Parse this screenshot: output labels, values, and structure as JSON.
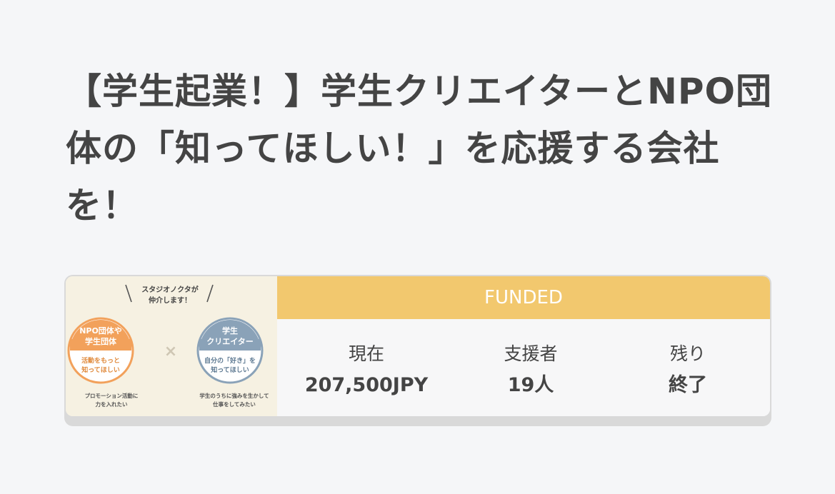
{
  "project": {
    "title": "【学生起業！】学生クリエイターとNPO団体の「知ってほしい！」を応援する会社を！"
  },
  "thumbnail": {
    "tagline": "スタジオノクタが仲介します！",
    "left_circle_title": "NPO団体や学生団体",
    "left_circle_sub": "活動をもっと知ってほしい",
    "right_circle_title": "学生クリエイター",
    "right_circle_sub": "自分の「好き」を知ってほしい",
    "cross": "×",
    "left_caption": "プロモーション活動に力を入れたい",
    "right_caption": "学生のうちに強みを生かして仕事をしてみたい",
    "colors": {
      "left_circle": "#f2a15b",
      "right_circle": "#8aa2b8",
      "background": "#f6f1e2"
    }
  },
  "status": {
    "label": "FUNDED",
    "color": "#f2c86e"
  },
  "stats": {
    "current_label": "現在",
    "current_value": "207,500JPY",
    "supporters_label": "支援者",
    "supporters_value": "19人",
    "remaining_label": "残り",
    "remaining_value": "終了"
  }
}
